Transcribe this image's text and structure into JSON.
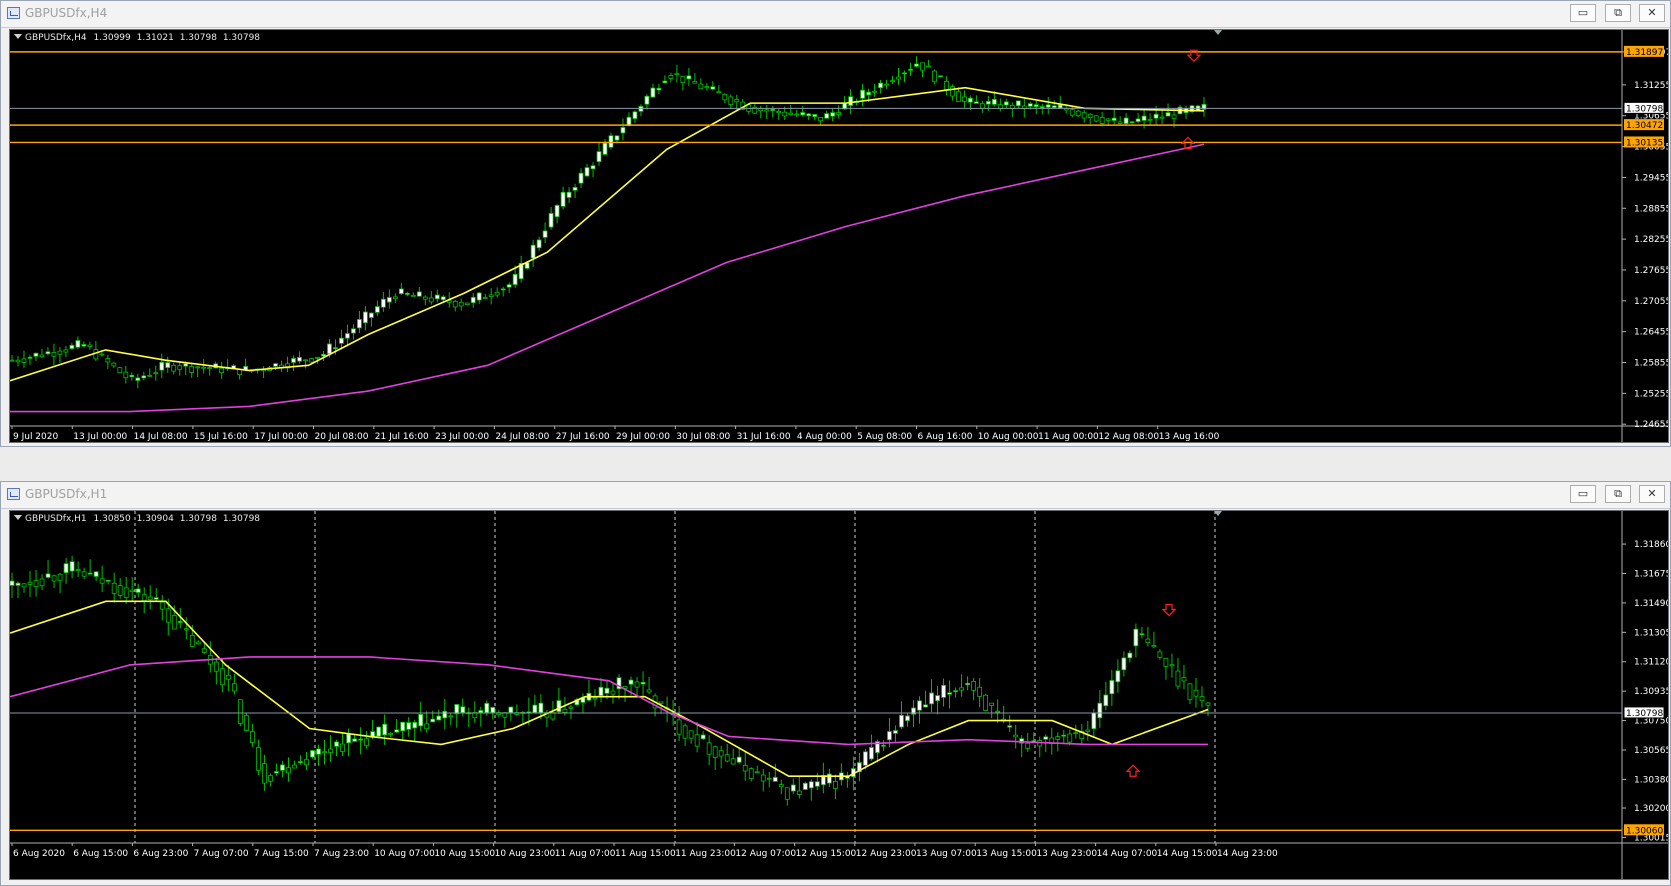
{
  "windows": [
    {
      "id": "h4",
      "title": "GBPUSDfx,H4",
      "symbol_label": "GBPUSDfx,H4",
      "ohlc": [
        "1.30999",
        "1.31021",
        "1.30798",
        "1.30798"
      ],
      "price_labels": [
        "1.31897",
        "1.31255",
        "1.30655",
        "1.30055",
        "1.29455",
        "1.28855",
        "1.28255",
        "1.27655",
        "1.27055",
        "1.26455",
        "1.25855",
        "1.25255",
        "1.24655"
      ],
      "time_labels": [
        "9 Jul 2020",
        "13 Jul 00:00",
        "14 Jul 08:00",
        "15 Jul 16:00",
        "17 Jul 00:00",
        "20 Jul 08:00",
        "21 Jul 16:00",
        "23 Jul 00:00",
        "24 Jul 08:00",
        "27 Jul 16:00",
        "29 Jul 00:00",
        "30 Jul 08:00",
        "31 Jul 16:00",
        "4 Aug 00:00",
        "5 Aug 08:00",
        "6 Aug 16:00",
        "10 Aug 00:00",
        "11 Aug 00:00",
        "12 Aug 08:00",
        "13 Aug 16:00"
      ],
      "current_price": "1.30798",
      "levels": [
        "1.31897",
        "1.30472",
        "1.30135"
      ]
    },
    {
      "id": "h1",
      "title": "GBPUSDfx,H1",
      "symbol_label": "GBPUSDfx,H1",
      "ohlc": [
        "1.30850",
        "1.30904",
        "1.30798",
        "1.30798"
      ],
      "price_labels": [
        "1.31860",
        "1.31675",
        "1.31490",
        "1.31305",
        "1.31120",
        "1.30935",
        "1.30750",
        "1.30565",
        "1.30380",
        "1.30200",
        "1.30015"
      ],
      "time_labels": [
        "6 Aug 2020",
        "6 Aug 15:00",
        "6 Aug 23:00",
        "7 Aug 07:00",
        "7 Aug 15:00",
        "7 Aug 23:00",
        "10 Aug 07:00",
        "10 Aug 15:00",
        "10 Aug 23:00",
        "11 Aug 07:00",
        "11 Aug 15:00",
        "11 Aug 23:00",
        "12 Aug 07:00",
        "12 Aug 15:00",
        "12 Aug 23:00",
        "13 Aug 07:00",
        "13 Aug 15:00",
        "13 Aug 23:00",
        "14 Aug 07:00",
        "14 Aug 15:00",
        "14 Aug 23:00"
      ],
      "current_price": "1.30798",
      "levels": [
        "1.30060"
      ]
    }
  ],
  "window_buttons": {
    "minimize": "▭",
    "restore": "⧉",
    "close": "✕"
  },
  "colors": {
    "background": "#000000",
    "bull_candle": "#ffffff",
    "bear_candle": "#000000",
    "wick": "#00c000",
    "ma_fast": "#ffff40",
    "ma_slow": "#e040e0",
    "level_line": "#ffa500",
    "arrow": "#ff2020",
    "text": "#ffffff"
  }
}
